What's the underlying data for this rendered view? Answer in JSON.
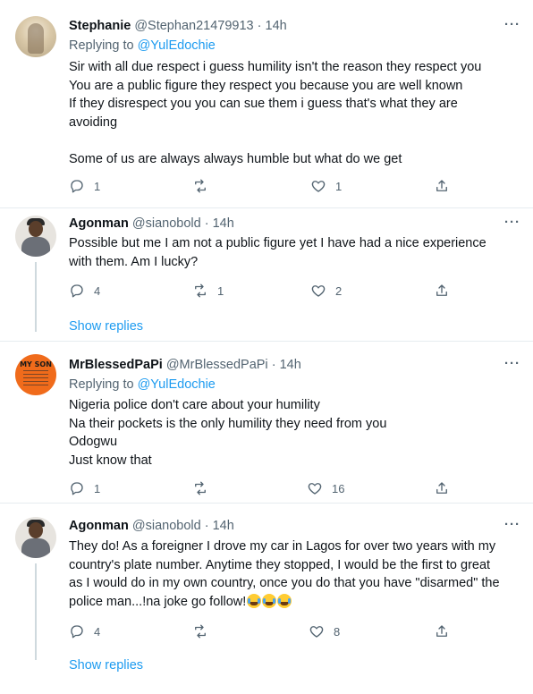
{
  "tweets": [
    {
      "name": "Stephanie",
      "handle": "@Stephan21479913",
      "separator": "·",
      "time": "14h",
      "more": "···",
      "replying_prefix": "Replying to ",
      "replying_to": "@YulEdochie",
      "lines": [
        "Sir with all due respect i guess humility isn't the reason they respect you",
        "You are a public figure they respect you because you are well known",
        "If they disrespect you you can sue them i guess that's what they are",
        "avoiding",
        "",
        "Some of us are always always humble but what do we get"
      ],
      "replies": "1",
      "retweets": "",
      "likes": "1"
    },
    {
      "name": "Agonman",
      "handle": "@sianobold",
      "separator": "·",
      "time": "14h",
      "more": "···",
      "lines": [
        "Possible but me I am not a public figure yet I have had a nice experience",
        "with them. Am I lucky?"
      ],
      "replies": "4",
      "retweets": "1",
      "likes": "2",
      "show_replies": "Show replies"
    },
    {
      "name": "MrBlessedPaPi",
      "handle": "@MrBlessedPaPi",
      "separator": "·",
      "time": "14h",
      "more": "···",
      "avatar_text": "MY SON",
      "replying_prefix": "Replying to ",
      "replying_to": "@YulEdochie",
      "lines": [
        "Nigeria police don't care about your humility",
        "Na their pockets is the only humility they need from you",
        "Odogwu",
        "Just know that"
      ],
      "replies": "1",
      "retweets": "",
      "likes": "16"
    },
    {
      "name": "Agonman",
      "handle": "@sianobold",
      "separator": "·",
      "time": "14h",
      "more": "···",
      "lines": [
        "They do! As a foreigner I drove my car in Lagos for over two years with my",
        "country's plate number. Anytime they stopped, I would be the first to great",
        "as I would do in my own country, once you do that you have \"disarmed\" the",
        "police man...!na joke go follow!"
      ],
      "replies": "4",
      "retweets": "",
      "likes": "8",
      "show_replies": "Show replies"
    }
  ],
  "colors": {
    "link": "#1d9bf0",
    "secondary_text": "#536471",
    "primary_text": "#0f1419",
    "divider": "#e6ecf0"
  },
  "icons": {
    "reply": "reply-icon",
    "retweet": "retweet-icon",
    "like": "heart-icon",
    "share": "share-icon",
    "more": "more-icon",
    "emoji": "face-with-tears-of-joy-icon"
  }
}
